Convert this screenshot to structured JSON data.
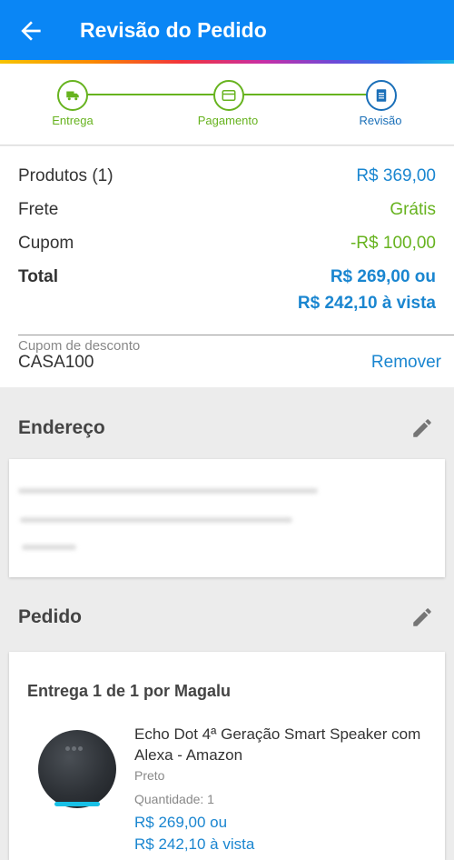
{
  "header": {
    "title": "Revisão do Pedido"
  },
  "stepper": {
    "steps": [
      {
        "label": "Entrega",
        "icon": "truck-icon"
      },
      {
        "label": "Pagamento",
        "icon": "card-icon"
      },
      {
        "label": "Revisão",
        "icon": "receipt-icon"
      }
    ]
  },
  "summary": {
    "products_label": "Produtos (1)",
    "products_value": "R$ 369,00",
    "shipping_label": "Frete",
    "shipping_value": "Grátis",
    "coupon_label": "Cupom",
    "coupon_value": "-R$ 100,00",
    "total_label": "Total",
    "total_value": "R$ 269,00 ou",
    "total_cash": "R$ 242,10 à vista"
  },
  "coupon": {
    "field_label": "Cupom de desconto",
    "value": "CASA100",
    "remove_label": "Remover"
  },
  "address": {
    "title": "Endereço"
  },
  "order": {
    "title": "Pedido",
    "delivery_header": "Entrega 1 de 1 por Magalu",
    "product": {
      "name": "Echo Dot 4ª Geração Smart Speaker com Alexa - Amazon",
      "color": "Preto",
      "quantity": "Quantidade:  1",
      "price": "R$ 269,00 ou",
      "cash_price": "R$ 242,10 à vista"
    }
  },
  "colors": {
    "primary": "#0a86f5",
    "accent_blue": "#1a86d0",
    "success": "#67b31f"
  }
}
